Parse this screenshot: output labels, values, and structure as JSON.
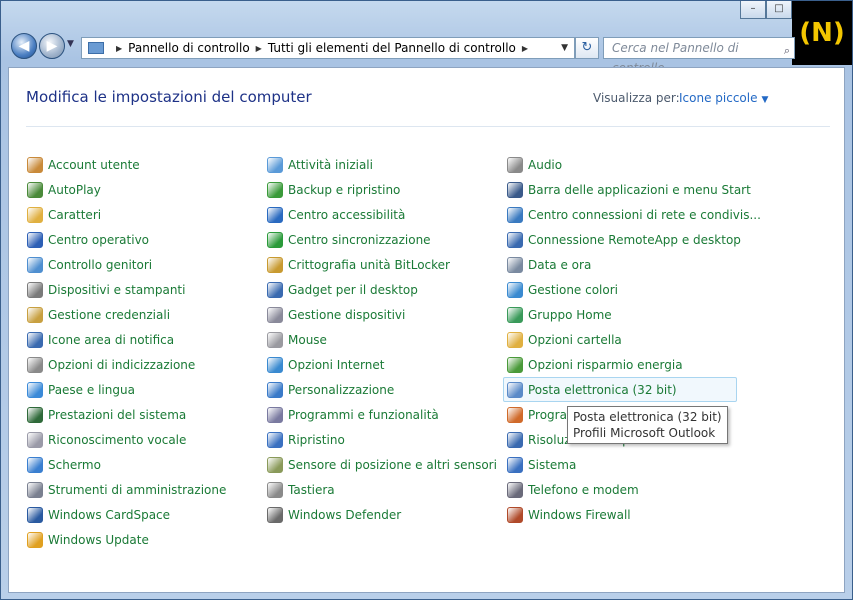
{
  "window": {
    "caption": {
      "minimize": "–",
      "maximize": "□",
      "close": "x"
    },
    "logo_text": "(N)"
  },
  "navbar": {
    "back": "◀",
    "forward": "▶",
    "dropdown": "▼",
    "address_segments": [
      "Pannello di controllo",
      "Tutti gli elementi del Pannello di controllo"
    ],
    "address_dropdown": "▼",
    "refresh_label": "↻",
    "search_placeholder": "Cerca nel Pannello di controllo",
    "search_icon": "⌕"
  },
  "header": {
    "title": "Modifica le impostazioni del computer",
    "view_label": "Visualizza per:",
    "view_value": "Icone piccole",
    "view_arrow": "▼"
  },
  "columns": [
    [
      {
        "label": "Account utente",
        "icon": "users-icon",
        "color": "#c98a3a"
      },
      {
        "label": "AutoPlay",
        "icon": "autoplay-icon",
        "color": "#4a8a3a"
      },
      {
        "label": "Caratteri",
        "icon": "fonts-icon",
        "color": "#e0b040"
      },
      {
        "label": "Centro operativo",
        "icon": "flag-icon",
        "color": "#2d5fb5"
      },
      {
        "label": "Controllo genitori",
        "icon": "parental-icon",
        "color": "#4f8fd0"
      },
      {
        "label": "Dispositivi e stampanti",
        "icon": "printer-icon",
        "color": "#7a7a7a"
      },
      {
        "label": "Gestione credenziali",
        "icon": "credentials-icon",
        "color": "#c8a040"
      },
      {
        "label": "Icone area di notifica",
        "icon": "notification-icon",
        "color": "#3a6ab0"
      },
      {
        "label": "Opzioni di indicizzazione",
        "icon": "indexing-icon",
        "color": "#8a8a8a"
      },
      {
        "label": "Paese e lingua",
        "icon": "globe-icon",
        "color": "#3b8ad8"
      },
      {
        "label": "Prestazioni del sistema",
        "icon": "performance-icon",
        "color": "#2f6a3a"
      },
      {
        "label": "Riconoscimento vocale",
        "icon": "microphone-icon",
        "color": "#9a9aa8"
      },
      {
        "label": "Schermo",
        "icon": "display-icon",
        "color": "#3a7fd0"
      },
      {
        "label": "Strumenti di amministrazione",
        "icon": "admin-tools-icon",
        "color": "#7a8090"
      },
      {
        "label": "Windows CardSpace",
        "icon": "cardspace-icon",
        "color": "#2a5aa0"
      },
      {
        "label": "Windows Update",
        "icon": "update-icon",
        "color": "#e0a020"
      }
    ],
    [
      {
        "label": "Attività iniziali",
        "icon": "getting-started-icon",
        "color": "#5a9ad8"
      },
      {
        "label": "Backup e ripristino",
        "icon": "backup-icon",
        "color": "#3a9a3a"
      },
      {
        "label": "Centro accessibilità",
        "icon": "accessibility-icon",
        "color": "#2a6ac0"
      },
      {
        "label": "Centro sincronizzazione",
        "icon": "sync-icon",
        "color": "#2a9a3a"
      },
      {
        "label": "Crittografia unità BitLocker",
        "icon": "bitlocker-icon",
        "color": "#c89a30"
      },
      {
        "label": "Gadget per il desktop",
        "icon": "gadget-icon",
        "color": "#3a6ab0"
      },
      {
        "label": "Gestione dispositivi",
        "icon": "device-manager-icon",
        "color": "#8a8a9a"
      },
      {
        "label": "Mouse",
        "icon": "mouse-icon",
        "color": "#9a9aa0"
      },
      {
        "label": "Opzioni Internet",
        "icon": "internet-options-icon",
        "color": "#3a8ad0"
      },
      {
        "label": "Personalizzazione",
        "icon": "personalization-icon",
        "color": "#3a7ac8"
      },
      {
        "label": "Programmi e funzionalità",
        "icon": "programs-icon",
        "color": "#7a7aa0"
      },
      {
        "label": "Ripristino",
        "icon": "recovery-icon",
        "color": "#3a70c0"
      },
      {
        "label": "Sensore di posizione e altri sensori",
        "icon": "sensor-icon",
        "color": "#8a9a5a"
      },
      {
        "label": "Tastiera",
        "icon": "keyboard-icon",
        "color": "#8a8a8a"
      },
      {
        "label": "Windows Defender",
        "icon": "defender-icon",
        "color": "#6a6a6a"
      }
    ],
    [
      {
        "label": "Audio",
        "icon": "speaker-icon",
        "color": "#8a8a8a"
      },
      {
        "label": "Barra delle applicazioni e menu Start",
        "icon": "taskbar-icon",
        "color": "#3a5a8a"
      },
      {
        "label": "Centro connessioni di rete e condivis...",
        "icon": "network-icon",
        "color": "#3a7ac0"
      },
      {
        "label": "Connessione RemoteApp e desktop",
        "icon": "remoteapp-icon",
        "color": "#3a6ab0"
      },
      {
        "label": "Data e ora",
        "icon": "clock-icon",
        "color": "#7a8aa0"
      },
      {
        "label": "Gestione colori",
        "icon": "color-management-icon",
        "color": "#3a8ad0"
      },
      {
        "label": "Gruppo Home",
        "icon": "homegroup-icon",
        "color": "#3a9a5a"
      },
      {
        "label": "Opzioni cartella",
        "icon": "folder-icon",
        "color": "#e0b040"
      },
      {
        "label": "Opzioni risparmio energia",
        "icon": "power-icon",
        "color": "#4a9a3a"
      },
      {
        "label": "Posta elettronica (32 bit)",
        "icon": "mail-icon",
        "color": "#5a8ac8",
        "hover": true
      },
      {
        "label": "Programmi predefiniti",
        "icon": "default-programs-icon",
        "color": "#d06a2a"
      },
      {
        "label": "Risoluzione dei problemi",
        "icon": "troubleshooting-icon",
        "color": "#3a6ab0"
      },
      {
        "label": "Sistema",
        "icon": "system-icon",
        "color": "#3a70c0"
      },
      {
        "label": "Telefono e modem",
        "icon": "phone-icon",
        "color": "#6a6a7a"
      },
      {
        "label": "Windows Firewall",
        "icon": "firewall-icon",
        "color": "#b04a2a"
      }
    ]
  ],
  "tooltip": {
    "line1": "Posta elettronica (32 bit)",
    "line2": "Profili Microsoft Outlook"
  }
}
